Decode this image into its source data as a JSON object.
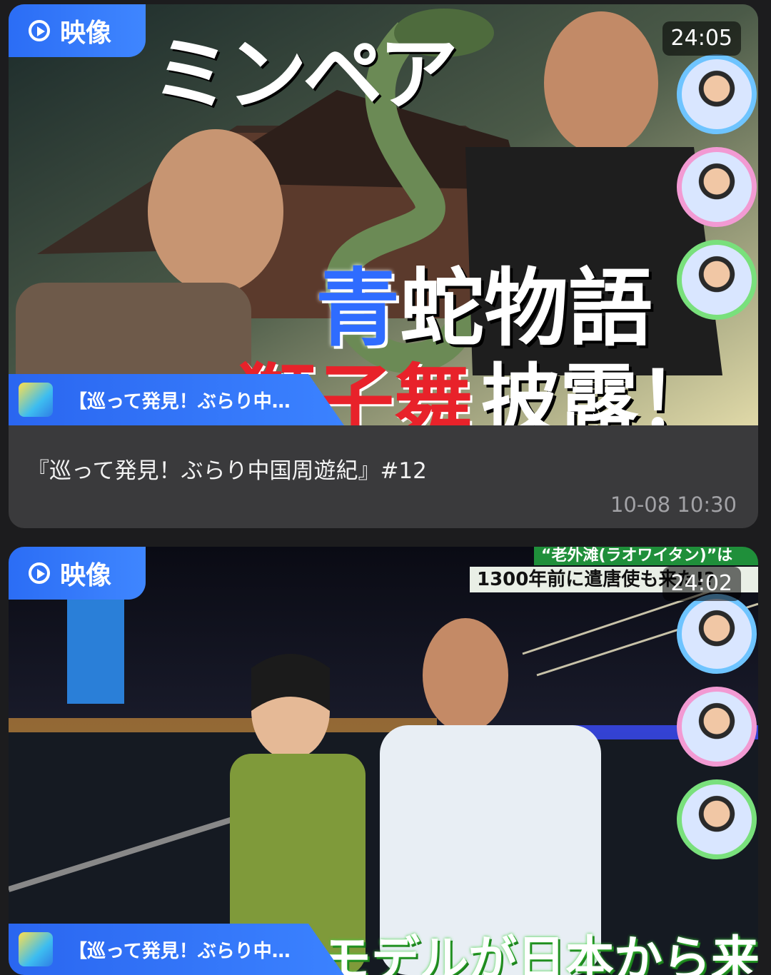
{
  "feed": [
    {
      "badge_label": "映像",
      "duration": "24:05",
      "source_label": "【巡って発見！ぶらり中…",
      "title": "『巡って発見！ぶらり中国周遊紀』#12",
      "date": "10-08 10:30",
      "overlay_text": {
        "top": "ミンペア",
        "main_blue": "青",
        "main_white": "蛇物語",
        "sub_red": "獅子舞",
        "sub_white": "披露！"
      }
    },
    {
      "badge_label": "映像",
      "duration": "24:02",
      "source_label": "【巡って発見！ぶらり中…",
      "overlay_text": {
        "banner_top": "“老外滩(ラオワイタン)”は",
        "banner_mid": "1300年前に遣唐使も来た!?",
        "subtitle": "モデルが日本から来てる"
      }
    }
  ],
  "colors": {
    "accent_blue": "#2f74ff",
    "card_bg": "#3a3a3c",
    "page_bg": "#1c1c1e"
  },
  "icons": [
    "play-circle-icon",
    "program-logo-icon"
  ]
}
